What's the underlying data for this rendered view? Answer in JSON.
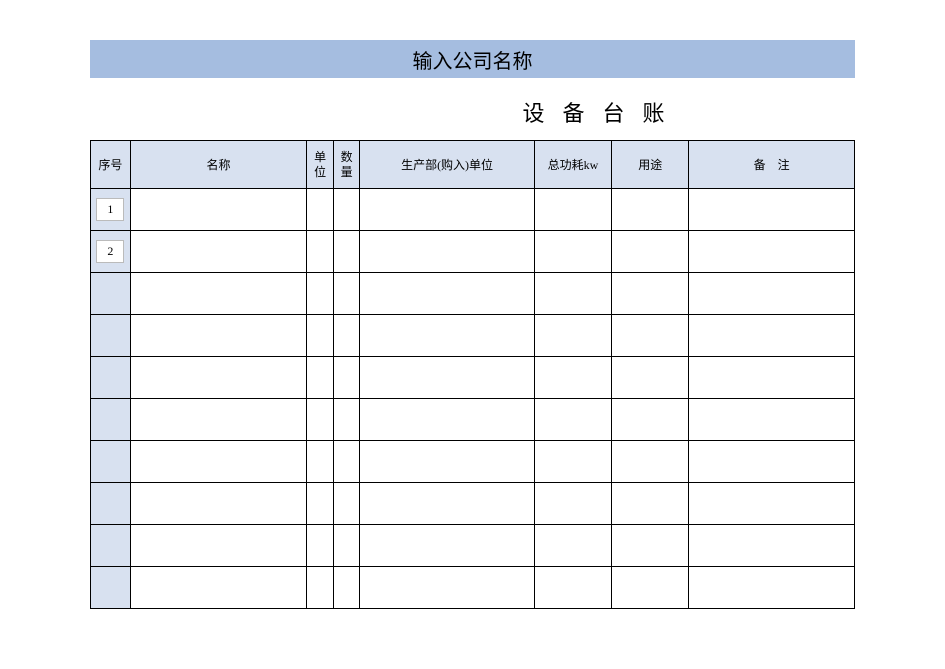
{
  "title": "输入公司名称",
  "subtitle": "设备台账",
  "headers": {
    "seq": "序号",
    "name": "名称",
    "unit": "单位",
    "qty": "数量",
    "dept": "生产部(购入)单位",
    "power": "总功耗kw",
    "use": "用途",
    "note": "备　注"
  },
  "rows": [
    {
      "seq": "1",
      "name": "",
      "unit": "",
      "qty": "",
      "dept": "",
      "power": "",
      "use": "",
      "note": ""
    },
    {
      "seq": "2",
      "name": "",
      "unit": "",
      "qty": "",
      "dept": "",
      "power": "",
      "use": "",
      "note": ""
    },
    {
      "seq": "",
      "name": "",
      "unit": "",
      "qty": "",
      "dept": "",
      "power": "",
      "use": "",
      "note": ""
    },
    {
      "seq": "",
      "name": "",
      "unit": "",
      "qty": "",
      "dept": "",
      "power": "",
      "use": "",
      "note": ""
    },
    {
      "seq": "",
      "name": "",
      "unit": "",
      "qty": "",
      "dept": "",
      "power": "",
      "use": "",
      "note": ""
    },
    {
      "seq": "",
      "name": "",
      "unit": "",
      "qty": "",
      "dept": "",
      "power": "",
      "use": "",
      "note": ""
    },
    {
      "seq": "",
      "name": "",
      "unit": "",
      "qty": "",
      "dept": "",
      "power": "",
      "use": "",
      "note": ""
    },
    {
      "seq": "",
      "name": "",
      "unit": "",
      "qty": "",
      "dept": "",
      "power": "",
      "use": "",
      "note": ""
    },
    {
      "seq": "",
      "name": "",
      "unit": "",
      "qty": "",
      "dept": "",
      "power": "",
      "use": "",
      "note": ""
    },
    {
      "seq": "",
      "name": "",
      "unit": "",
      "qty": "",
      "dept": "",
      "power": "",
      "use": "",
      "note": ""
    }
  ]
}
